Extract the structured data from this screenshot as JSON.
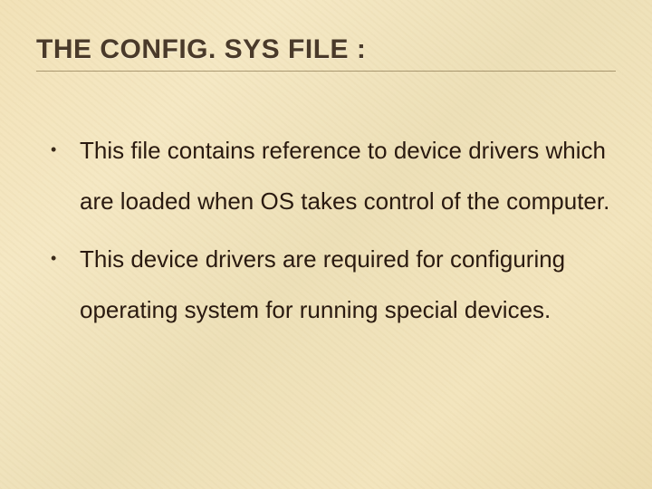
{
  "slide": {
    "title": "THE CONFIG. SYS FILE :",
    "bullets": [
      "This file contains reference to device drivers which are loaded when OS takes control of the computer.",
      "This device drivers are required for configuring operating system for running special devices."
    ]
  }
}
